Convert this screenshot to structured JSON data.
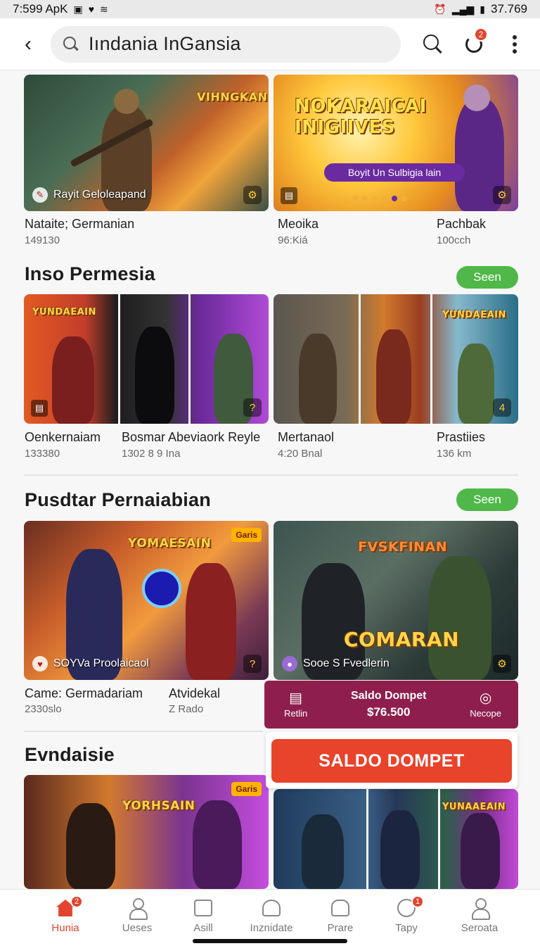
{
  "status_bar": {
    "time": "7:599 ApK",
    "battery": "37.769"
  },
  "header": {
    "search_text": "Iındania InGansia",
    "notifications_badge": "2"
  },
  "top_row": [
    {
      "art_title": "VIHNGKAN",
      "caption": "Rayit Geloleapand",
      "label": "Nataite; Germanian",
      "sub": "149130"
    },
    {
      "art_title": "NOKARAICAI INIGIIVES",
      "art_subtitle": "Boyit Un Sulbigia lain",
      "label": "Meoika",
      "sub": "96:Kiá",
      "label2": "Pachbak",
      "sub2": "100cch"
    }
  ],
  "section1": {
    "title": "Inso Permesia",
    "seen_label": "Seen",
    "items": [
      {
        "art_title": "YUNDAEAIN",
        "label": "Oenkernaiam",
        "sub": "133380"
      },
      {
        "label": "Bosmar Abeviaork Reyle",
        "sub": "1302 8 9 Ina"
      },
      {
        "label": "Mertanaol",
        "sub": "4:20 Bnal"
      },
      {
        "art_title": "YUNDAEAIN",
        "label": "Prastiies",
        "sub": "136 km"
      }
    ]
  },
  "section2": {
    "title": "Pusdtar Pernaiabian",
    "seen_label": "Seen",
    "items": [
      {
        "art_title": "YOMAESAIN",
        "tag": "Garis",
        "caption": "SOYVa Proolaicaol",
        "label": "Came: Germadariam",
        "sub": "2330slo",
        "label2": "Atvidekal",
        "sub2": "Z Rado"
      },
      {
        "art_title": "FVSKFINAN",
        "art_title2": "COMARAN",
        "caption": "Sooe S Fvedlerin"
      }
    ]
  },
  "wallet": {
    "left_label": "Retlin",
    "title": "Saldo Dompet",
    "amount": "$76.500",
    "right_label": "Necope",
    "button_label": "SALDO DOMPET"
  },
  "section3": {
    "title": "Evndaisie",
    "items": [
      {
        "art_title": "YORHSAIN",
        "tag": "Garis"
      },
      {
        "art_title": "YUNAAEAIN"
      }
    ]
  },
  "bottom_nav": {
    "items": [
      {
        "label": "Hunia",
        "icon": "home-icon",
        "badge": "2",
        "active": true
      },
      {
        "label": "Ueses",
        "icon": "user-icon"
      },
      {
        "label": "Asill",
        "icon": "document-icon"
      },
      {
        "label": "Inznidate",
        "icon": "house-outline-icon"
      },
      {
        "label": "Prare",
        "icon": "bag-icon"
      },
      {
        "label": "Tapy",
        "icon": "gauge-icon",
        "badge": "1"
      },
      {
        "label": "Seroata",
        "icon": "profile-icon"
      }
    ]
  },
  "colors": {
    "accent": "#e2442d",
    "seen": "#4fb848",
    "wallet": "#8e1f4d"
  }
}
